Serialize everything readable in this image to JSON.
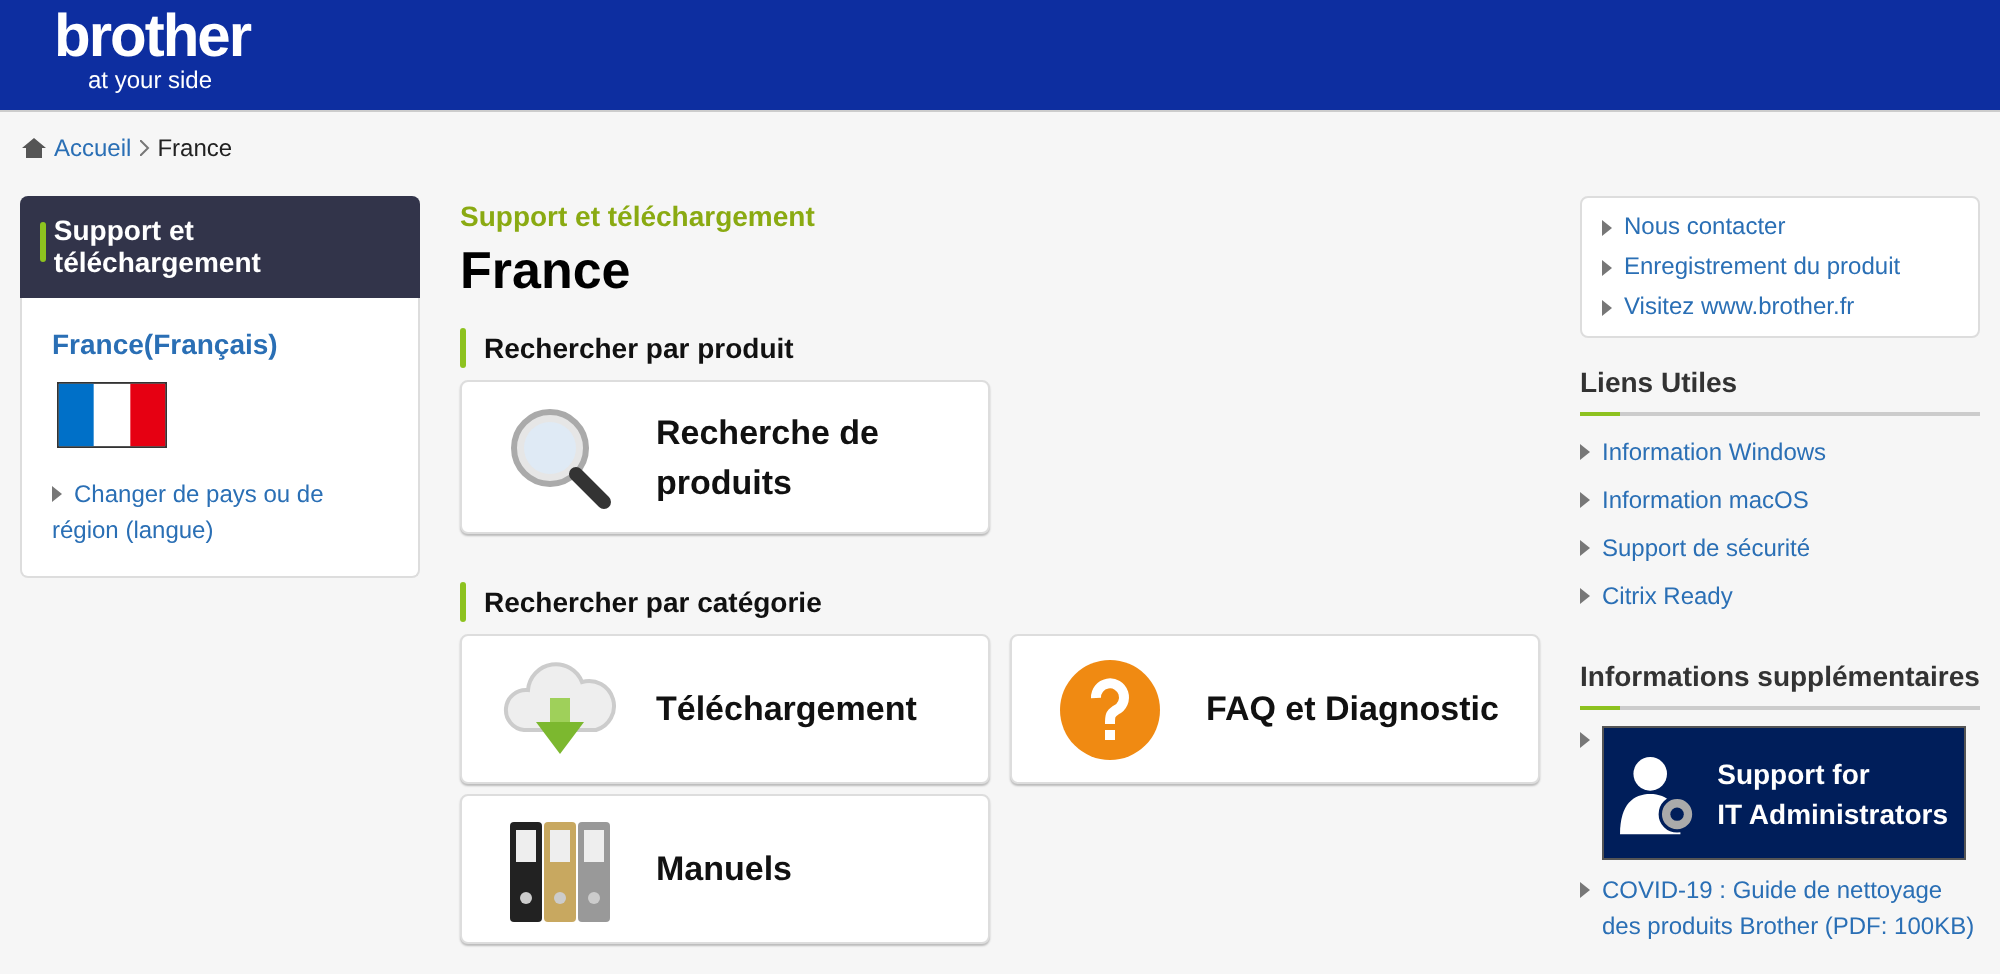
{
  "header": {
    "logo": "brother",
    "tagline": "at your side"
  },
  "breadcrumb": [
    {
      "label": "Accueil",
      "kind": "link"
    },
    {
      "label": "France",
      "kind": "current"
    }
  ],
  "sidebar": {
    "title": "Support et téléchargement",
    "country": "France(Français)",
    "change_link": "Changer de pays ou de région (langue)"
  },
  "main": {
    "eyebrow": "Support et téléchargement",
    "title": "France",
    "sections": [
      {
        "heading": "Rechercher par produit",
        "cards": [
          {
            "label": "Recherche de produits",
            "kind": "search"
          }
        ]
      },
      {
        "heading": "Rechercher par catégorie",
        "cards": [
          {
            "label": "Téléchargement",
            "kind": "download"
          },
          {
            "label": "FAQ et Diagnostic",
            "kind": "faq"
          },
          {
            "label": "Manuels",
            "kind": "manuals"
          }
        ]
      }
    ]
  },
  "right": {
    "quick_links": [
      "Nous contacter",
      "Enregistrement du produit",
      "Visitez www.brother.fr"
    ],
    "useful": {
      "title": "Liens Utiles",
      "links": [
        "Information Windows",
        "Information macOS",
        "Support de sécurité",
        "Citrix Ready"
      ]
    },
    "extra": {
      "title": "Informations supplémentaires",
      "banner": {
        "line1": "Support for",
        "line2": "IT Administrators"
      },
      "link": "COVID-19 : Guide de nettoyage des produits Brother (PDF: 100KB)"
    }
  }
}
